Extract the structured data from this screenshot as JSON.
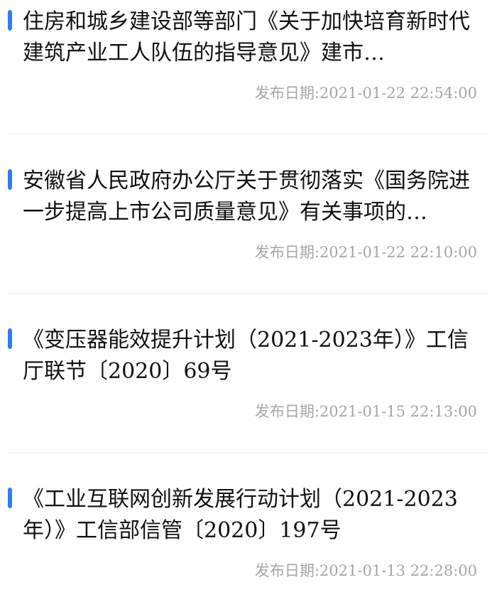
{
  "colors": {
    "accent": "#2f7df6",
    "title_text": "#111111",
    "date_text": "#a6a6a6",
    "divider": "#ececec"
  },
  "articles": [
    {
      "title": "住房和城乡建设部等部门《关于加快培育新时代建筑产业工人队伍的指导意见》建市…",
      "date_label": "发布日期:2021-01-22 22:54:00"
    },
    {
      "title": "安徽省人民政府办公厅关于贯彻落实《国务院进一步提高上市公司质量意见》有关事项的…",
      "date_label": "发布日期:2021-01-22 22:10:00"
    },
    {
      "title": "《变压器能效提升计划（2021-2023年）》工信厅联节〔2020〕69号",
      "date_label": "发布日期:2021-01-15 22:13:00"
    },
    {
      "title": "《工业互联网创新发展行动计划（2021-2023年）》工信部信管〔2020〕197号",
      "date_label": "发布日期:2021-01-13 22:28:00"
    }
  ]
}
